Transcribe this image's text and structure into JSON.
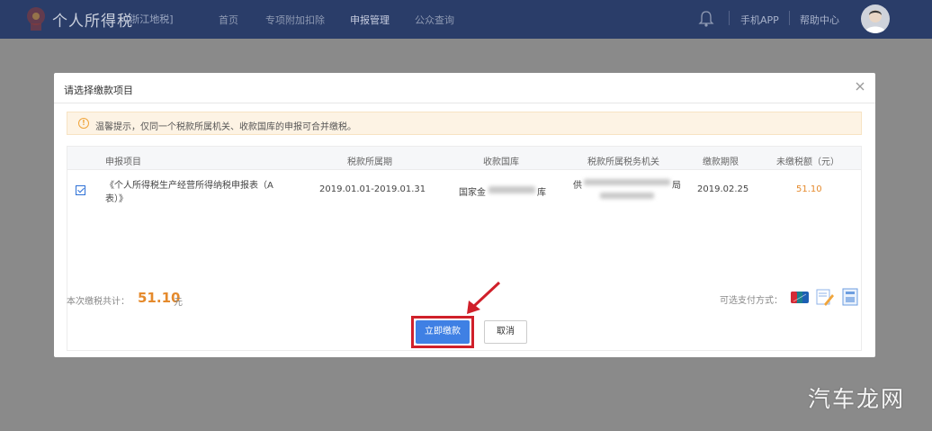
{
  "topbar": {
    "app_title": "个人所得税",
    "region": "[浙江地税]",
    "nav": [
      "首页",
      "专项附加扣除",
      "申报管理",
      "公众查询"
    ],
    "mobile_app": "手机APP",
    "help": "帮助中心",
    "icons": {
      "bell": "bell-icon",
      "avatar": "avatar"
    }
  },
  "modal": {
    "title": "请选择缴款项目",
    "tip": "温馨提示，仅同一个税款所属机关、收款国库的申报可合并缴税。",
    "table": {
      "headers": [
        "申报项目",
        "税款所属期",
        "收款国库",
        "税款所属税务机关",
        "缴款期限",
        "未缴税额（元）"
      ],
      "rows": [
        {
          "checked": true,
          "item_line1": "《个人所得税生产经营所得纳税申报表（A",
          "item_line2": "表）》",
          "period": "2019.01.01-2019.01.31",
          "treasury_prefix": "国家金",
          "treasury_suffix": "库",
          "authority_prefix": "供",
          "authority_suffix": "局",
          "deadline": "2019.02.25",
          "amount": "51.10"
        }
      ]
    },
    "total_label": "本次缴税共计：",
    "total_amount": "51.10",
    "total_unit": "元",
    "pay_methods_label": "可选支付方式：",
    "pay_method_icons": [
      "unionpay-icon",
      "edit-pay-icon",
      "print-pay-icon"
    ],
    "buttons": {
      "pay_now": "立即缴款",
      "cancel": "取消"
    }
  },
  "watermark": "汽车龙网",
  "colors": {
    "primary": "#3f80e4",
    "amount": "#e58a2c",
    "highlight": "#d0202a",
    "header_bg": "#2a3d69"
  }
}
